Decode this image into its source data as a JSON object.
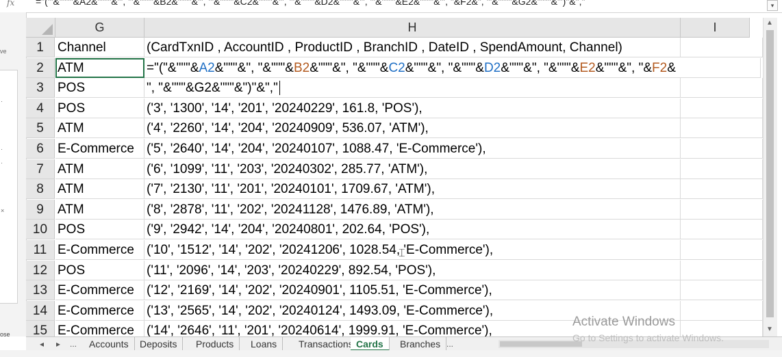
{
  "formula_bar": {
    "fx_label": "fx",
    "formula": "=\"('\"&\"\"\"\"&A2&\"\"\"\"&\"', '\"&\"\"\"\"&B2&\"\"\"\"&\"', '\"&\"\"\"\"&C2&\"\"\"\"&\"', '\"&\"\"\"\"&D2&\"\"\"\"&\"', '\"&\"\"\"\"&E2&\"\"\"\"&\"', \"&F2&\", '\"&\"\"\"\"&G2&\"\"\"\"&\"')\"&\",\""
  },
  "left_pane": {
    "text_top": "ve",
    "text_bottom": "ose"
  },
  "columns": [
    {
      "label": "G"
    },
    {
      "label": "H"
    },
    {
      "label": "I"
    }
  ],
  "rows": [
    {
      "num": "1",
      "g": "Channel",
      "h": "(CardTxnID , AccountID , ProductID , BranchID , DateID , SpendAmount, Channel)"
    },
    {
      "num": "2",
      "g": "ATM"
    },
    {
      "num": "3",
      "g": "POS",
      "h": "\", \"&\"\"\"&G2&\"\"\"&\")\"&\",\""
    },
    {
      "num": "4",
      "g": "POS",
      "h": "('3', '1300', '14', '201', '20240229', 161.8, 'POS'),"
    },
    {
      "num": "5",
      "g": "ATM",
      "h": "('4', '2260', '14', '204', '20240909', 536.07, 'ATM'),"
    },
    {
      "num": "6",
      "g": "E-Commerce",
      "h": "('5', '2640', '14', '204', '20240107', 1088.47, 'E-Commerce'),"
    },
    {
      "num": "7",
      "g": "ATM",
      "h": "('6', '1099', '11', '203', '20240302', 285.77, 'ATM'),"
    },
    {
      "num": "8",
      "g": "ATM",
      "h": "('7', '2130', '11', '201', '20240101', 1709.67, 'ATM'),"
    },
    {
      "num": "9",
      "g": "ATM",
      "h": "('8', '2878', '11', '202', '20241128', 1476.89, 'ATM'),"
    },
    {
      "num": "10",
      "g": "POS",
      "h": "('9', '2942', '14', '204', '20240801', 202.64, 'POS'),"
    },
    {
      "num": "11",
      "g": "E-Commerce",
      "h": "('10', '1512', '14', '202', '20241206', 1028.54, 'E-Commerce'),"
    },
    {
      "num": "12",
      "g": "POS",
      "h": "('11', '2096', '14', '203', '20240229', 892.54, 'POS'),"
    },
    {
      "num": "13",
      "g": "E-Commerce",
      "h": "('12', '2169', '14', '202', '20240901', 1105.51, 'E-Commerce'),"
    },
    {
      "num": "14",
      "g": "E-Commerce",
      "h": "('13', '2565', '14', '202', '20240124', 1493.09, 'E-Commerce'),"
    },
    {
      "num": "15",
      "g": "E-Commerce",
      "h": "('14', '2646', '11', '201', '20240614', 1999.91, 'E-Commerce'),"
    }
  ],
  "editing_cell": {
    "prefix": "=\"(\"&\"\"\"&",
    "segments": [
      {
        "ref": "A2",
        "color": "r2",
        "after": "&\"\"\"&\", \"&\"\"\"&"
      },
      {
        "ref": "B2",
        "color": "r1",
        "after": "&\"\"\"&\", \"&\"\"\"&"
      },
      {
        "ref": "C2",
        "color": "r2",
        "after": "&\"\"\"&\", \"&\"\"\"&"
      },
      {
        "ref": "D2",
        "color": "r2",
        "after": "&\"\"\"&\", \"&\"\"\"&"
      },
      {
        "ref": "E2",
        "color": "r1",
        "after": "&\"\"\"&\", \"&"
      },
      {
        "ref": "F2",
        "color": "r1",
        "after": "&"
      }
    ]
  },
  "tabs": {
    "nav_first": "◂",
    "nav_next": "▸",
    "ellipsis_left": "...",
    "items": [
      "Accounts",
      "Deposits",
      "Products",
      "Loans",
      "Transactions",
      "Cards",
      "Branches"
    ],
    "active": "Cards",
    "ellipsis_right": "..."
  },
  "watermark": {
    "title": "Activate Windows",
    "subtitle": "Go to Settings to activate Windows."
  }
}
